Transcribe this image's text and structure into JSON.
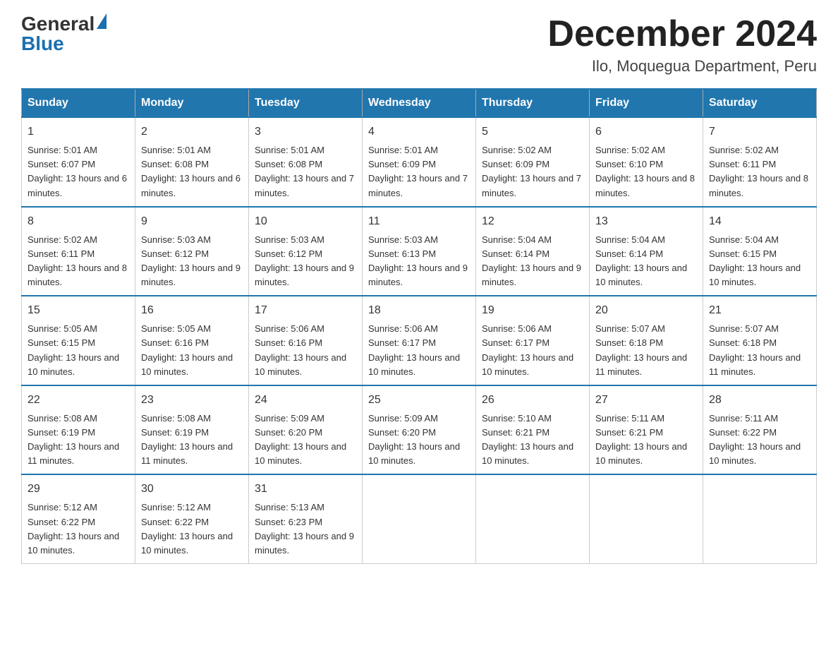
{
  "header": {
    "logo_general": "General",
    "logo_blue": "Blue",
    "month_title": "December 2024",
    "location": "Ilo, Moquegua Department, Peru"
  },
  "days_of_week": [
    "Sunday",
    "Monday",
    "Tuesday",
    "Wednesday",
    "Thursday",
    "Friday",
    "Saturday"
  ],
  "weeks": [
    [
      {
        "day": "1",
        "sunrise": "5:01 AM",
        "sunset": "6:07 PM",
        "daylight": "13 hours and 6 minutes."
      },
      {
        "day": "2",
        "sunrise": "5:01 AM",
        "sunset": "6:08 PM",
        "daylight": "13 hours and 6 minutes."
      },
      {
        "day": "3",
        "sunrise": "5:01 AM",
        "sunset": "6:08 PM",
        "daylight": "13 hours and 7 minutes."
      },
      {
        "day": "4",
        "sunrise": "5:01 AM",
        "sunset": "6:09 PM",
        "daylight": "13 hours and 7 minutes."
      },
      {
        "day": "5",
        "sunrise": "5:02 AM",
        "sunset": "6:09 PM",
        "daylight": "13 hours and 7 minutes."
      },
      {
        "day": "6",
        "sunrise": "5:02 AM",
        "sunset": "6:10 PM",
        "daylight": "13 hours and 8 minutes."
      },
      {
        "day": "7",
        "sunrise": "5:02 AM",
        "sunset": "6:11 PM",
        "daylight": "13 hours and 8 minutes."
      }
    ],
    [
      {
        "day": "8",
        "sunrise": "5:02 AM",
        "sunset": "6:11 PM",
        "daylight": "13 hours and 8 minutes."
      },
      {
        "day": "9",
        "sunrise": "5:03 AM",
        "sunset": "6:12 PM",
        "daylight": "13 hours and 9 minutes."
      },
      {
        "day": "10",
        "sunrise": "5:03 AM",
        "sunset": "6:12 PM",
        "daylight": "13 hours and 9 minutes."
      },
      {
        "day": "11",
        "sunrise": "5:03 AM",
        "sunset": "6:13 PM",
        "daylight": "13 hours and 9 minutes."
      },
      {
        "day": "12",
        "sunrise": "5:04 AM",
        "sunset": "6:14 PM",
        "daylight": "13 hours and 9 minutes."
      },
      {
        "day": "13",
        "sunrise": "5:04 AM",
        "sunset": "6:14 PM",
        "daylight": "13 hours and 10 minutes."
      },
      {
        "day": "14",
        "sunrise": "5:04 AM",
        "sunset": "6:15 PM",
        "daylight": "13 hours and 10 minutes."
      }
    ],
    [
      {
        "day": "15",
        "sunrise": "5:05 AM",
        "sunset": "6:15 PM",
        "daylight": "13 hours and 10 minutes."
      },
      {
        "day": "16",
        "sunrise": "5:05 AM",
        "sunset": "6:16 PM",
        "daylight": "13 hours and 10 minutes."
      },
      {
        "day": "17",
        "sunrise": "5:06 AM",
        "sunset": "6:16 PM",
        "daylight": "13 hours and 10 minutes."
      },
      {
        "day": "18",
        "sunrise": "5:06 AM",
        "sunset": "6:17 PM",
        "daylight": "13 hours and 10 minutes."
      },
      {
        "day": "19",
        "sunrise": "5:06 AM",
        "sunset": "6:17 PM",
        "daylight": "13 hours and 10 minutes."
      },
      {
        "day": "20",
        "sunrise": "5:07 AM",
        "sunset": "6:18 PM",
        "daylight": "13 hours and 11 minutes."
      },
      {
        "day": "21",
        "sunrise": "5:07 AM",
        "sunset": "6:18 PM",
        "daylight": "13 hours and 11 minutes."
      }
    ],
    [
      {
        "day": "22",
        "sunrise": "5:08 AM",
        "sunset": "6:19 PM",
        "daylight": "13 hours and 11 minutes."
      },
      {
        "day": "23",
        "sunrise": "5:08 AM",
        "sunset": "6:19 PM",
        "daylight": "13 hours and 11 minutes."
      },
      {
        "day": "24",
        "sunrise": "5:09 AM",
        "sunset": "6:20 PM",
        "daylight": "13 hours and 10 minutes."
      },
      {
        "day": "25",
        "sunrise": "5:09 AM",
        "sunset": "6:20 PM",
        "daylight": "13 hours and 10 minutes."
      },
      {
        "day": "26",
        "sunrise": "5:10 AM",
        "sunset": "6:21 PM",
        "daylight": "13 hours and 10 minutes."
      },
      {
        "day": "27",
        "sunrise": "5:11 AM",
        "sunset": "6:21 PM",
        "daylight": "13 hours and 10 minutes."
      },
      {
        "day": "28",
        "sunrise": "5:11 AM",
        "sunset": "6:22 PM",
        "daylight": "13 hours and 10 minutes."
      }
    ],
    [
      {
        "day": "29",
        "sunrise": "5:12 AM",
        "sunset": "6:22 PM",
        "daylight": "13 hours and 10 minutes."
      },
      {
        "day": "30",
        "sunrise": "5:12 AM",
        "sunset": "6:22 PM",
        "daylight": "13 hours and 10 minutes."
      },
      {
        "day": "31",
        "sunrise": "5:13 AM",
        "sunset": "6:23 PM",
        "daylight": "13 hours and 9 minutes."
      },
      null,
      null,
      null,
      null
    ]
  ],
  "labels": {
    "sunrise_prefix": "Sunrise: ",
    "sunset_prefix": "Sunset: ",
    "daylight_prefix": "Daylight: "
  }
}
